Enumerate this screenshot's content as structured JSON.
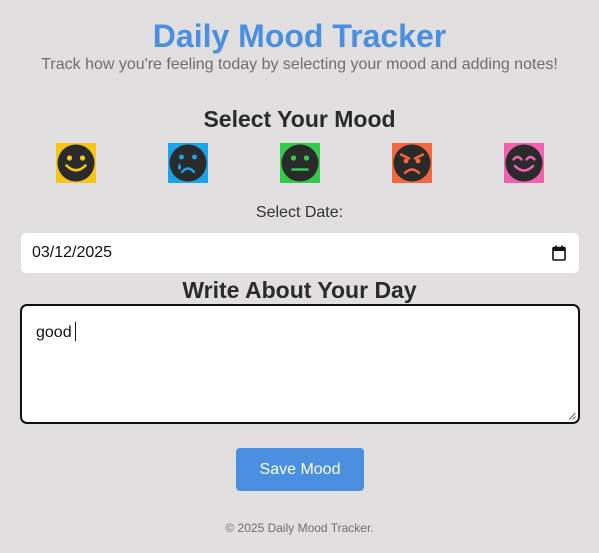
{
  "header": {
    "title": "Daily Mood Tracker",
    "subtitle": "Track how you're feeling today by selecting your mood and adding notes!"
  },
  "mood_section": {
    "heading": "Select Your Mood",
    "moods": [
      {
        "icon": "happy-face-icon",
        "color": "#f5c518"
      },
      {
        "icon": "crying-face-icon",
        "color": "#1aa3e8"
      },
      {
        "icon": "neutral-face-icon",
        "color": "#33c94a"
      },
      {
        "icon": "angry-face-icon",
        "color": "#f26640"
      },
      {
        "icon": "smiling-eyes-face-icon",
        "color": "#f062ae"
      }
    ]
  },
  "date_field": {
    "label": "Select Date:",
    "value": "03/12/2025",
    "icon": "calendar-icon"
  },
  "notes": {
    "heading": "Write About Your Day",
    "value": "good"
  },
  "actions": {
    "save_label": "Save Mood",
    "button_color": "#4a8fe0"
  },
  "footer": {
    "text": "© 2025 Daily Mood Tracker."
  },
  "colors": {
    "background": "#e1dfdf",
    "title": "#4a8fe0",
    "face": "#2a2a2a"
  }
}
